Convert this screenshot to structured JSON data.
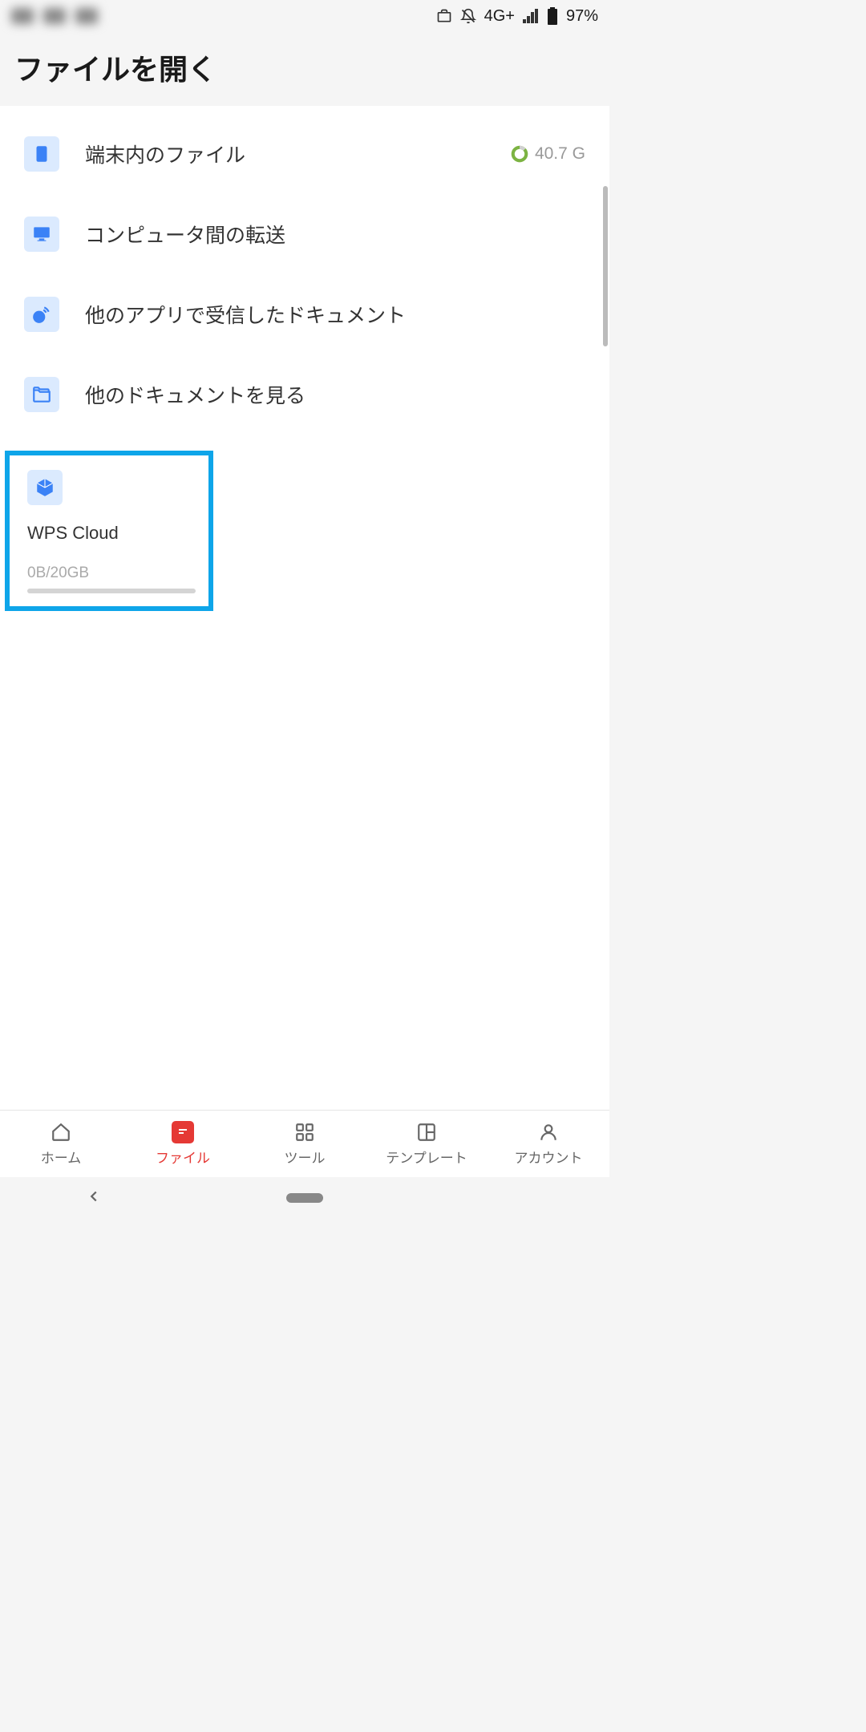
{
  "status_bar": {
    "network": "4G+",
    "battery": "97%"
  },
  "header": {
    "title": "ファイルを開く"
  },
  "menu_items": [
    {
      "label": "端末内のファイル",
      "storage": "40.7 G",
      "has_storage": true
    },
    {
      "label": "コンピュータ間の転送"
    },
    {
      "label": "他のアプリで受信したドキュメント"
    },
    {
      "label": "他のドキュメントを見る"
    }
  ],
  "cloud": {
    "label": "WPS Cloud",
    "usage": "0B/20GB"
  },
  "bottom_nav": [
    {
      "label": "ホーム"
    },
    {
      "label": "ファイル",
      "active": true
    },
    {
      "label": "ツール"
    },
    {
      "label": "テンプレート"
    },
    {
      "label": "アカウント"
    }
  ]
}
